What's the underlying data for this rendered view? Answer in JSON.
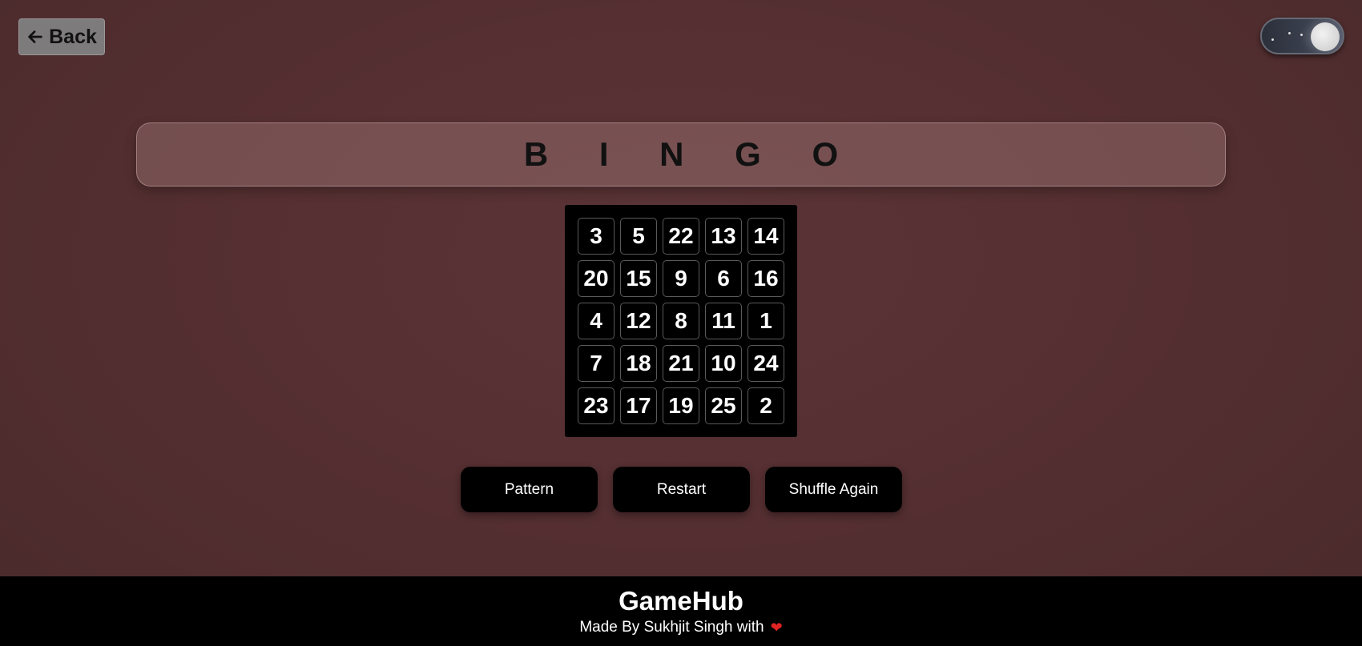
{
  "header": {
    "back_label": "Back",
    "back_icon": "arrow-left-icon",
    "theme_toggle_icon": "moon-icon"
  },
  "game": {
    "title": "B I N G O",
    "board": [
      [
        "3",
        "5",
        "22",
        "13",
        "14"
      ],
      [
        "20",
        "15",
        "9",
        "6",
        "16"
      ],
      [
        "4",
        "12",
        "8",
        "11",
        "1"
      ],
      [
        "7",
        "18",
        "21",
        "10",
        "24"
      ],
      [
        "23",
        "17",
        "19",
        "25",
        "2"
      ]
    ]
  },
  "actions": {
    "pattern_label": "Pattern",
    "restart_label": "Restart",
    "shuffle_label": "Shuffle Again"
  },
  "footer": {
    "title": "GameHub",
    "credit": "Made By Sukhjit Singh with",
    "heart_icon": "heart-icon"
  },
  "colors": {
    "background": "#552f31",
    "board": "#000000",
    "heart": "#e02424"
  }
}
